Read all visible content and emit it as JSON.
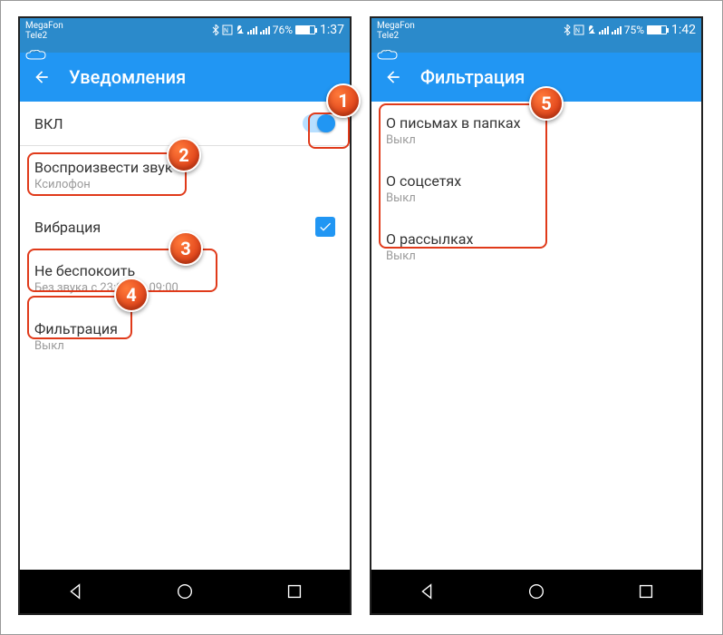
{
  "left": {
    "status": {
      "carrier1": "MegaFon",
      "carrier2": "Tele2",
      "battery_pct": "76%",
      "time": "1:37"
    },
    "appbar": {
      "title": "Уведомления"
    },
    "row_enable": {
      "label": "ВКЛ"
    },
    "row_sound": {
      "primary": "Воспроизвести звук",
      "secondary": "Ксилофон"
    },
    "row_vibration": {
      "primary": "Вибрация"
    },
    "row_dnd": {
      "primary": "Не беспокоить",
      "secondary": "Без звука с 23:00 до 09:00"
    },
    "row_filter": {
      "primary": "Фильтрация",
      "secondary": "Выкл"
    }
  },
  "right": {
    "status": {
      "carrier1": "MegaFon",
      "carrier2": "Tele2",
      "battery_pct": "75%",
      "time": "1:42"
    },
    "appbar": {
      "title": "Фильтрация"
    },
    "row_folders": {
      "primary": "О письмах в папках",
      "secondary": "Выкл"
    },
    "row_social": {
      "primary": "О соцсетях",
      "secondary": "Выкл"
    },
    "row_newsletters": {
      "primary": "О рассылках",
      "secondary": "Выкл"
    }
  },
  "badges": {
    "b1": "1",
    "b2": "2",
    "b3": "3",
    "b4": "4",
    "b5": "5"
  }
}
